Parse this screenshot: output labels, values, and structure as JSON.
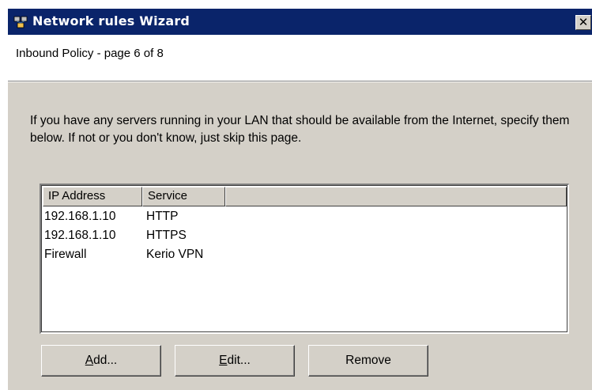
{
  "window": {
    "title": "Network rules Wizard",
    "close_glyph": "✕"
  },
  "header": {
    "page_title": "Inbound Policy - page 6 of 8"
  },
  "body": {
    "description": "If you have any servers running in your LAN that should be available from the Internet, specify them below. If not or you don't know, just skip this page."
  },
  "table": {
    "columns": [
      "IP Address",
      "Service",
      ""
    ],
    "rows": [
      {
        "ip": "192.168.1.10",
        "service": "HTTP"
      },
      {
        "ip": "192.168.1.10",
        "service": "HTTPS"
      },
      {
        "ip": "Firewall",
        "service": "Kerio VPN"
      }
    ]
  },
  "buttons": {
    "add": {
      "mnemonic": "A",
      "rest": "dd..."
    },
    "edit": {
      "mnemonic": "E",
      "rest": "dit..."
    },
    "remove": "Remove"
  },
  "colors": {
    "titlebar": "#0a246a",
    "dialog_face": "#d4d0c8"
  },
  "icons": {
    "title": "network-wizard-icon",
    "close": "close-icon"
  }
}
